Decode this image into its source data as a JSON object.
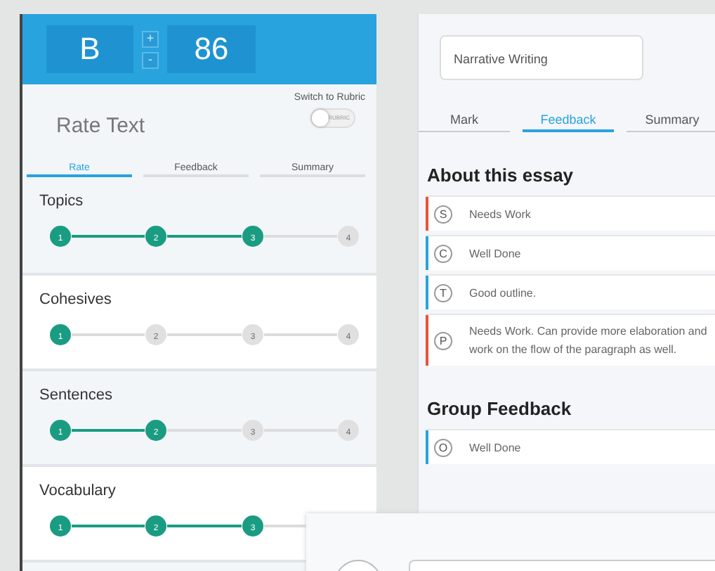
{
  "grade": {
    "letter": "B",
    "score": "86",
    "increase": "+",
    "decrease": "-"
  },
  "rate_panel": {
    "title": "Rate Text",
    "switch_label": "Switch to Rubric",
    "toggle": {
      "label": "RUBRIC",
      "on": false
    },
    "tabs": [
      {
        "label": "Rate",
        "selected": true
      },
      {
        "label": "Feedback",
        "selected": false
      },
      {
        "label": "Summary",
        "selected": false
      }
    ],
    "criteria": [
      {
        "name": "Topics",
        "steps": [
          {
            "label": "1",
            "filled": true
          },
          {
            "label": "2",
            "filled": true
          },
          {
            "label": "3",
            "filled": true
          },
          {
            "label": "4",
            "filled": false
          }
        ]
      },
      {
        "name": "Cohesives",
        "steps": [
          {
            "label": "1",
            "filled": true
          },
          {
            "label": "2",
            "filled": false
          },
          {
            "label": "3",
            "filled": false
          },
          {
            "label": "4",
            "filled": false
          }
        ]
      },
      {
        "name": "Sentences",
        "steps": [
          {
            "label": "1",
            "filled": true
          },
          {
            "label": "2",
            "filled": true
          },
          {
            "label": "3",
            "filled": false
          },
          {
            "label": "4",
            "filled": false
          }
        ]
      },
      {
        "name": "Vocabulary",
        "steps": [
          {
            "label": "1",
            "filled": true
          },
          {
            "label": "2",
            "filled": true
          },
          {
            "label": "3",
            "filled": true
          }
        ]
      }
    ]
  },
  "feedback_panel": {
    "title_field": "Narrative Writing",
    "tabs": [
      {
        "label": "Mark",
        "selected": false
      },
      {
        "label": "Feedback",
        "selected": true
      },
      {
        "label": "Summary",
        "selected": false
      }
    ],
    "sections": [
      {
        "heading": "About this essay",
        "items": [
          {
            "letter": "S",
            "text": "Needs Work",
            "color": "#e8533a"
          },
          {
            "letter": "C",
            "text": "Well Done",
            "color": "#29a3de"
          },
          {
            "letter": "T",
            "text": "Good outline.",
            "color": "#29a3de"
          },
          {
            "letter": "P",
            "text": "Needs Work. Can provide more elaboration and work on the flow of the paragraph as well.",
            "color": "#e8533a"
          }
        ]
      },
      {
        "heading": "Group Feedback",
        "items": [
          {
            "letter": "O",
            "text": "Well Done",
            "color": "#29a3de"
          }
        ]
      }
    ]
  }
}
